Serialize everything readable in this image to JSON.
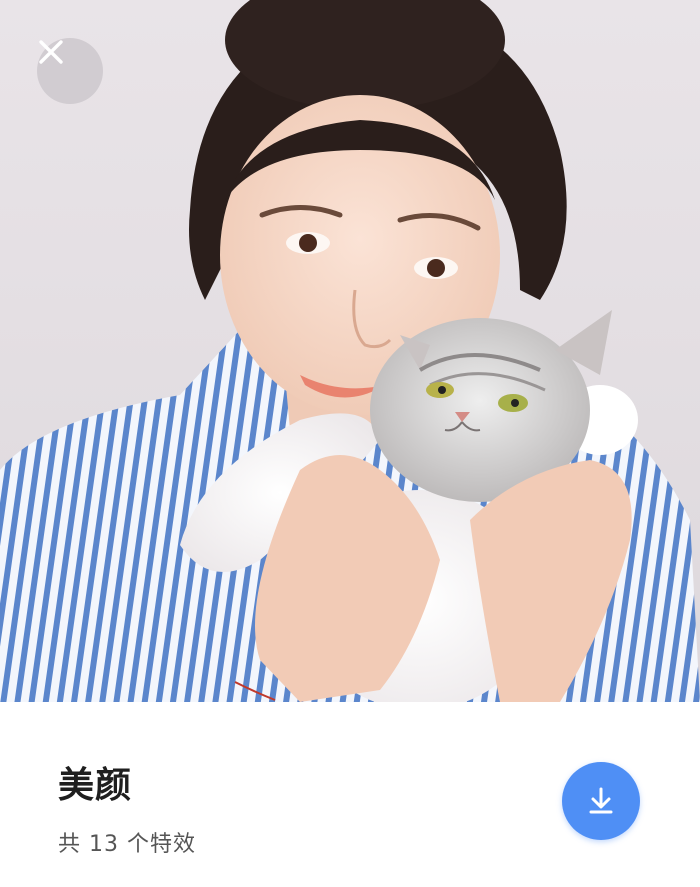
{
  "photo": {
    "alt": "美颜"
  },
  "effect": {
    "title": "美颜",
    "count_text": "共 13 个特效"
  },
  "colors": {
    "accent": "#4f8ff5",
    "title": "#1f1f1f",
    "subtitle": "#555555",
    "close_bg": "#cdc8cc"
  },
  "icons": {
    "close": "close-icon",
    "download": "download-icon"
  }
}
